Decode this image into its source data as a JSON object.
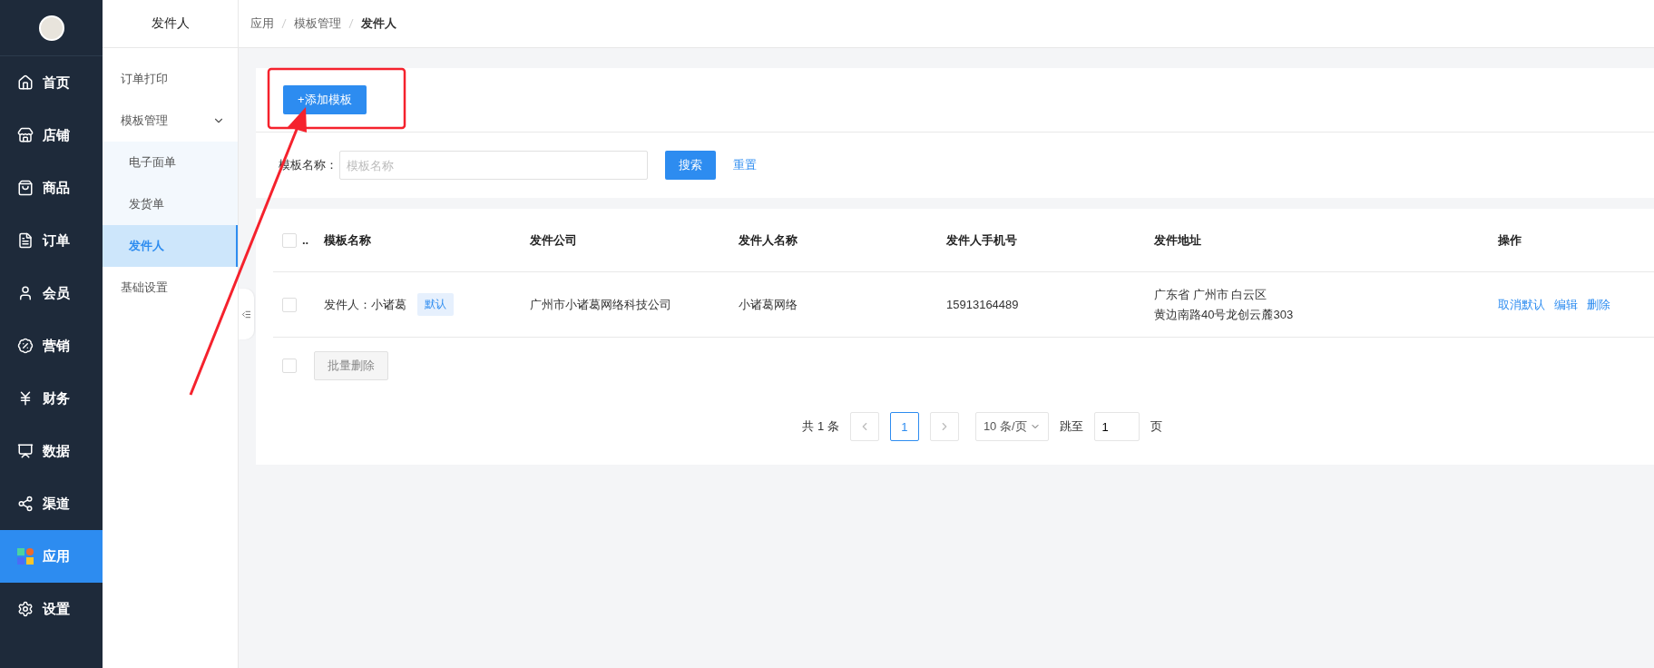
{
  "nav": {
    "items": [
      {
        "label": "首页",
        "selected": false
      },
      {
        "label": "店铺",
        "selected": false
      },
      {
        "label": "商品",
        "selected": false
      },
      {
        "label": "订单",
        "selected": false
      },
      {
        "label": "会员",
        "selected": false
      },
      {
        "label": "营销",
        "selected": false
      },
      {
        "label": "财务",
        "selected": false
      },
      {
        "label": "数据",
        "selected": false
      },
      {
        "label": "渠道",
        "selected": false
      },
      {
        "label": "应用",
        "selected": true
      },
      {
        "label": "设置",
        "selected": false
      }
    ]
  },
  "submenu": {
    "title": "发件人",
    "items": [
      {
        "label": "订单打印",
        "selected": false
      },
      {
        "label": "模板管理",
        "expanded": true,
        "children": [
          {
            "label": "电子面单",
            "selected": false
          },
          {
            "label": "发货单",
            "selected": false
          },
          {
            "label": "发件人",
            "selected": true
          }
        ]
      },
      {
        "label": "基础设置",
        "selected": false
      }
    ]
  },
  "breadcrumb": [
    "应用",
    "模板管理",
    "发件人"
  ],
  "add_button": "+添加模板",
  "filter": {
    "label": "模板名称：",
    "placeholder": "模板名称",
    "search_button": "搜索",
    "reset_link": "重置"
  },
  "table": {
    "select_all_checked": false,
    "select_all_truncated_label": "..",
    "columns": [
      "模板名称",
      "发件公司",
      "发件人名称",
      "发件人手机号",
      "发件地址",
      "操作"
    ],
    "rows": [
      {
        "checked": false,
        "name": "发件人：小诸葛",
        "tag": "默认",
        "company": "广州市小诸葛网络科技公司",
        "sender": "小诸葛网络",
        "phone": "15913164489",
        "address": [
          "广东省 广州市 白云区",
          "黄边南路40号龙创云麓303"
        ],
        "actions": [
          "取消默认",
          "编辑",
          "删除"
        ]
      }
    ],
    "footer_checked": false,
    "batch_delete": "批量删除"
  },
  "pagination": {
    "total": "共 1 条",
    "pages": [
      {
        "label": "1",
        "selected": true
      }
    ],
    "page_size": "10 条/页",
    "jump_label": "跳至",
    "jump_value": "1",
    "page_unit": "页"
  }
}
